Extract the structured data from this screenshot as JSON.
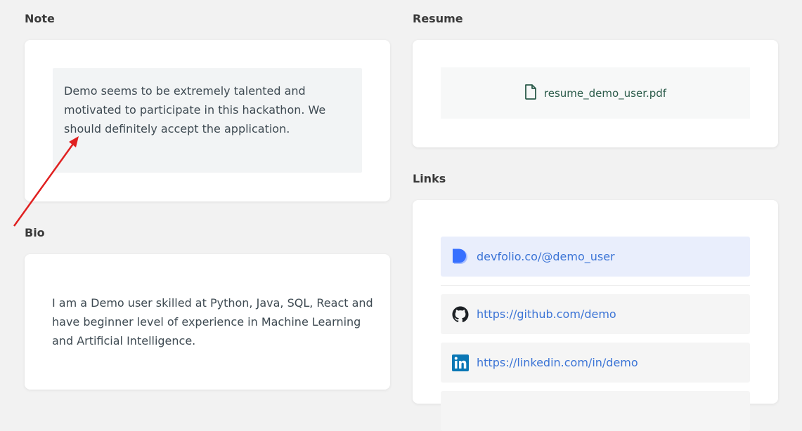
{
  "note": {
    "title": "Note",
    "text": "Demo seems to be extremely talented and motivated to participate in this hackathon. We should definitely accept the application."
  },
  "bio": {
    "title": "Bio",
    "text": "I am a Demo user skilled at Python, Java, SQL, React and have beginner level of experience in Machine Learning and Artificial Intelligence."
  },
  "resume": {
    "title": "Resume",
    "file_name": "resume_demo_user.pdf",
    "icon": "file-icon"
  },
  "links": {
    "title": "Links",
    "items": [
      {
        "label": "devfolio.co/@demo_user",
        "icon": "devfolio-icon"
      },
      {
        "label": "https://github.com/demo",
        "icon": "github-icon"
      },
      {
        "label": "https://linkedin.com/in/demo",
        "icon": "linkedin-icon"
      }
    ]
  },
  "colors": {
    "background": "#f2f2f2",
    "card": "#ffffff",
    "link": "#3b74d6",
    "annotation_arrow": "#e02020",
    "devfolio": "#3770ff",
    "linkedin": "#0a77b5"
  }
}
